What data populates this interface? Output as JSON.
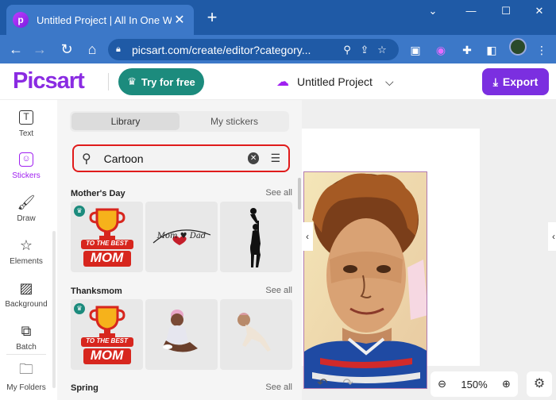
{
  "browser": {
    "tab_title": "Untitled Project | All In One Web",
    "favicon_letter": "p",
    "tab_close": "✕",
    "new_tab": "+",
    "url": "picsart.com/create/editor?category...",
    "window_controls": [
      "minimize-icon",
      "maximize-icon",
      "close-icon"
    ]
  },
  "header": {
    "logo": "Picsart",
    "try_free": "Try for free",
    "project_name": "Untitled Project",
    "export": "Export"
  },
  "left_tools": [
    {
      "label": "Text",
      "icon": "text-tool-icon"
    },
    {
      "label": "Stickers",
      "icon": "sticker-icon",
      "active": true
    },
    {
      "label": "Draw",
      "icon": "brush-icon"
    },
    {
      "label": "Elements",
      "icon": "star-icon"
    },
    {
      "label": "Background",
      "icon": "background-icon"
    },
    {
      "label": "Batch",
      "icon": "batch-icon"
    },
    {
      "label": "My Folders",
      "icon": "folder-icon"
    }
  ],
  "panel": {
    "tabs": [
      "Library",
      "My stickers"
    ],
    "active_tab": "Library",
    "search_value": "Cartoon",
    "sections": [
      {
        "title": "Mother's Day",
        "see_all": "See all"
      },
      {
        "title": "Thanksmom",
        "see_all": "See all"
      },
      {
        "title": "Spring",
        "see_all": "See all"
      }
    ],
    "sticker_text": {
      "to_the_best": "TO THE BEST",
      "mom": "MOM",
      "script": "Mom ♥ Dad"
    }
  },
  "canvas": {
    "zoom": "150%"
  },
  "colors": {
    "brand_purple": "#7b2fe0",
    "teal": "#1c8b7d",
    "browser_blue": "#3c78c8",
    "search_border": "#e01b1b"
  }
}
